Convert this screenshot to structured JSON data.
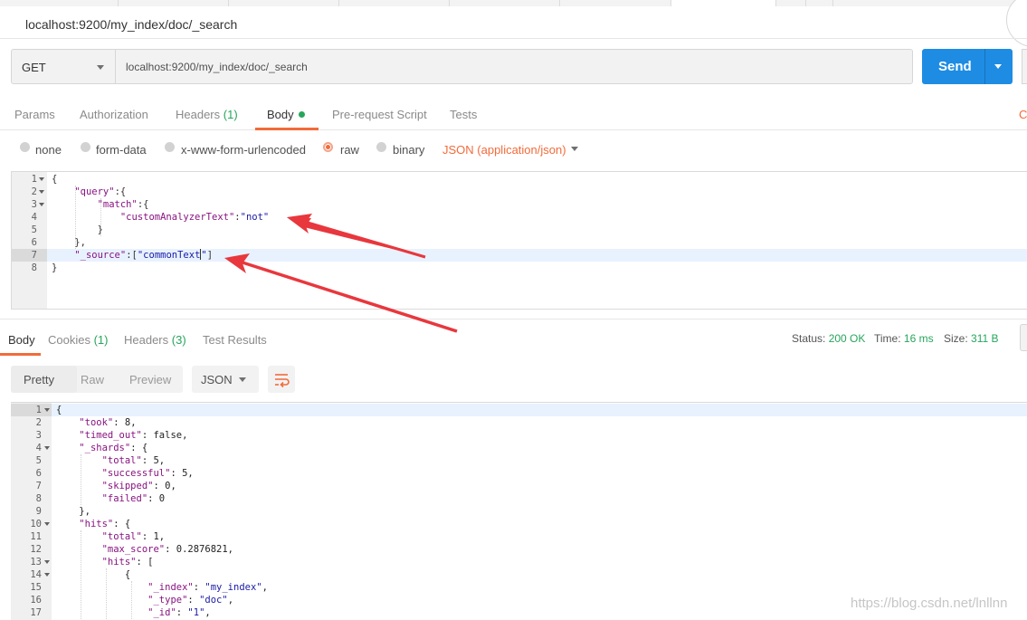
{
  "request": {
    "title": "localhost:9200/my_index/doc/_search",
    "method": "GET",
    "url": "localhost:9200/my_index/doc/_search",
    "send_label": "Send"
  },
  "request_tabs": [
    {
      "label": "Params",
      "count": ""
    },
    {
      "label": "Authorization",
      "count": ""
    },
    {
      "label": "Headers",
      "count": "(1)"
    },
    {
      "label": "Body",
      "count": ""
    },
    {
      "label": "Pre-request Script",
      "count": ""
    },
    {
      "label": "Tests",
      "count": ""
    }
  ],
  "request_tabs_right": "Co",
  "body_types": [
    "none",
    "form-data",
    "x-www-form-urlencoded",
    "raw",
    "binary"
  ],
  "selected_body_type": "raw",
  "content_type": "JSON (application/json)",
  "request_body_lines": [
    "{",
    "    \"query\":{",
    "        \"match\":{",
    "            \"customAnalyzerText\":\"not\"",
    "        }",
    "    },",
    "    \"_source\":[\"commonText\"]",
    "}"
  ],
  "response_tabs": [
    {
      "label": "Body",
      "count": ""
    },
    {
      "label": "Cookies",
      "count": "(1)"
    },
    {
      "label": "Headers",
      "count": "(3)"
    },
    {
      "label": "Test Results",
      "count": ""
    }
  ],
  "status": {
    "status_label": "Status:",
    "status_value": "200 OK",
    "time_label": "Time:",
    "time_value": "16 ms",
    "size_label": "Size:",
    "size_value": "311 B"
  },
  "view_modes": [
    "Pretty",
    "Raw",
    "Preview"
  ],
  "format": "JSON",
  "response_lines": [
    "{",
    "    \"took\": 8,",
    "    \"timed_out\": false,",
    "    \"_shards\": {",
    "        \"total\": 5,",
    "        \"successful\": 5,",
    "        \"skipped\": 0,",
    "        \"failed\": 0",
    "    },",
    "    \"hits\": {",
    "        \"total\": 1,",
    "        \"max_score\": 0.2876821,",
    "        \"hits\": [",
    "            {",
    "                \"_index\": \"my_index\",",
    "                \"_type\": \"doc\",",
    "                \"_id\": \"1\","
  ],
  "watermark": "https://blog.csdn.net/lnllnn",
  "colors": {
    "accent": "#f26b3a",
    "send_blue": "#1e8ce3",
    "success_green": "#26a65b",
    "arrow_red": "#e8373d"
  }
}
